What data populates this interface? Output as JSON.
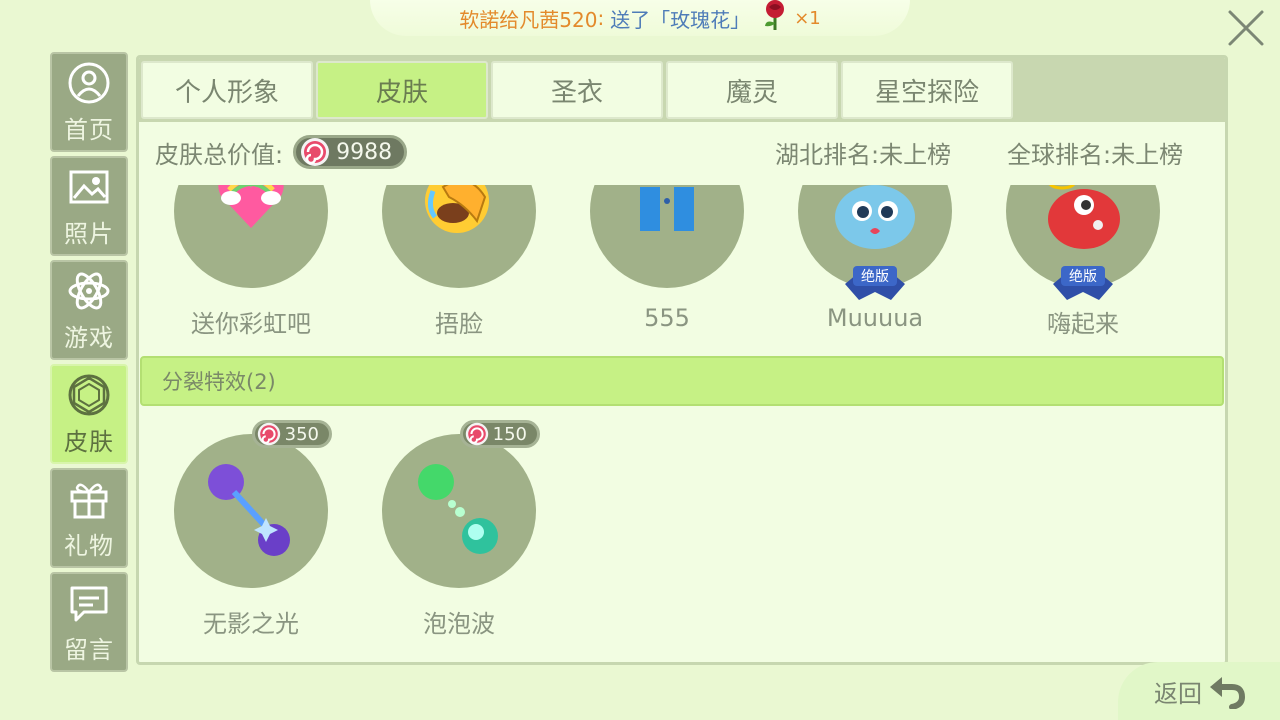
{
  "banner": {
    "sender": "软諾给",
    "recipient": "凡茜520",
    "separator": ":",
    "message": "送了「玫瑰花」",
    "count": "×1"
  },
  "sidenav": [
    {
      "label": "首页",
      "icon": "home-icon"
    },
    {
      "label": "照片",
      "icon": "photo-icon"
    },
    {
      "label": "游戏",
      "icon": "atom-icon"
    },
    {
      "label": "皮肤",
      "icon": "skin-icon"
    },
    {
      "label": "礼物",
      "icon": "gift-icon"
    },
    {
      "label": "留言",
      "icon": "message-icon"
    }
  ],
  "tabs": [
    "个人形象",
    "皮肤",
    "圣衣",
    "魔灵",
    "星空探险"
  ],
  "active_tab": "皮肤",
  "stats": {
    "total_label": "皮肤总价值:",
    "total_value": "9988",
    "province_rank": "湖北排名:未上榜",
    "global_rank": "全球排名:未上榜"
  },
  "emote_items": [
    {
      "label": "送你彩虹吧",
      "icon": "rainbow-heart-icon"
    },
    {
      "label": "捂脸",
      "icon": "facepalm-icon"
    },
    {
      "label": "555",
      "icon": "crying-eyes-icon"
    },
    {
      "label": "Muuuua",
      "icon": "blue-blob-kiss-icon",
      "badge": "绝版"
    },
    {
      "label": "嗨起来",
      "icon": "red-blob-party-icon",
      "badge": "绝版"
    }
  ],
  "section": {
    "title": "分裂特效(2)"
  },
  "split_items": [
    {
      "label": "无影之光",
      "price": "350",
      "icon": "purple-split-icon"
    },
    {
      "label": "泡泡波",
      "price": "150",
      "icon": "green-split-icon"
    }
  ],
  "back": {
    "label": "返回"
  },
  "colors": {
    "accent": "#c6f185",
    "nav": "#9aa985",
    "banner_orange": "#e38a2b",
    "banner_blue": "#4e7cb8"
  }
}
